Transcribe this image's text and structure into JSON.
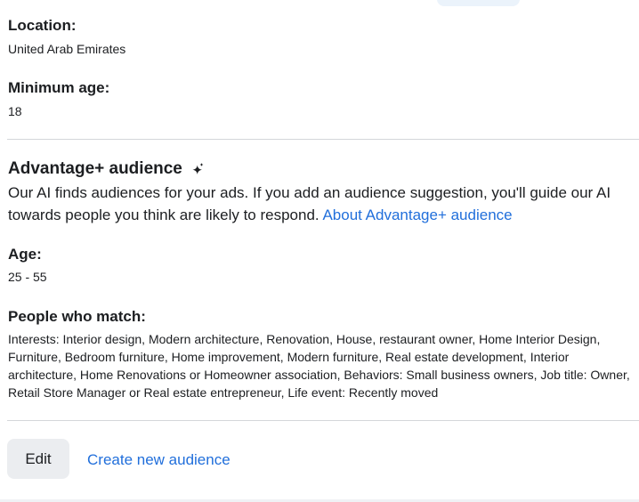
{
  "location": {
    "label": "Location:",
    "value": "United Arab Emirates"
  },
  "minimum_age": {
    "label": "Minimum age:",
    "value": "18"
  },
  "advantage": {
    "heading": "Advantage+ audience",
    "icon": "sparkle-icon",
    "description": "Our AI finds audiences for your ads. If you add an audience suggestion, you'll guide our AI towards people you think are likely to respond.",
    "link_text": "About Advantage+ audience"
  },
  "age": {
    "label": "Age:",
    "value": "25 - 55"
  },
  "people_match": {
    "label": "People who match:",
    "value": "Interests: Interior design, Modern architecture, Renovation, House, restaurant owner, Home Interior Design, Furniture, Bedroom furniture, Home improvement, Modern furniture, Real estate development, Interior architecture, Home Renovations or Homeowner association, Behaviors: Small business owners, Job title: Owner, Retail Store Manager or Real estate entrepreneur, Life event: Recently moved"
  },
  "actions": {
    "edit_label": "Edit",
    "create_label": "Create new audience"
  },
  "colors": {
    "link": "#216fdb",
    "button_bg": "#ebedf0",
    "divider": "#d4d6da"
  }
}
